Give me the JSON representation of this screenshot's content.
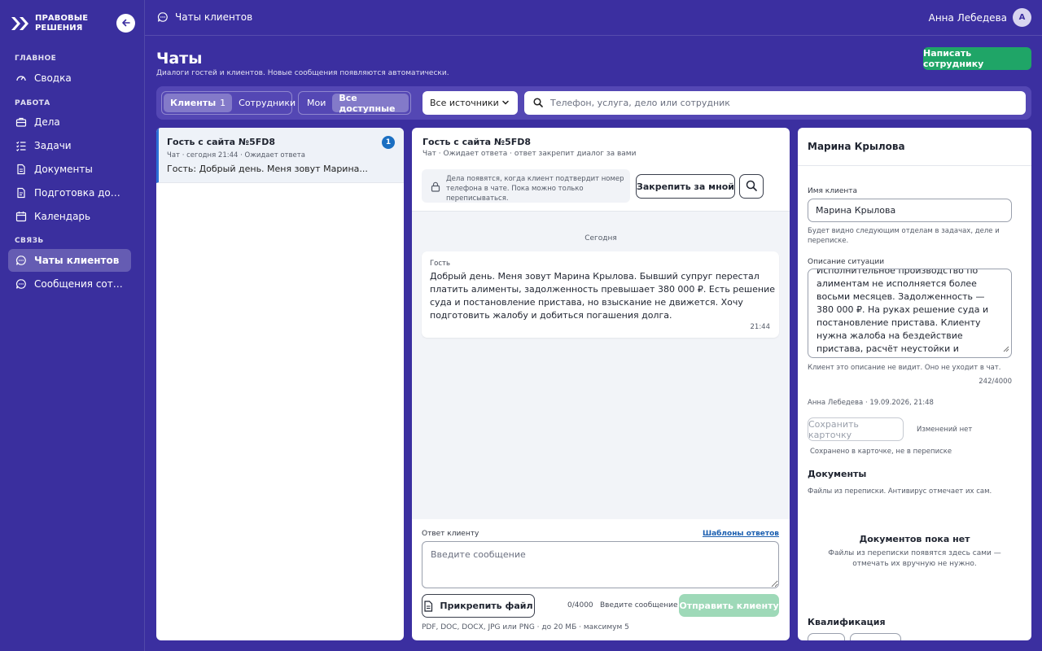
{
  "brand": {
    "line1": "ПРАВОВЫЕ",
    "line2": "РЕШЕНИЯ"
  },
  "sidebar": {
    "sections": [
      {
        "title": "ГЛАВНОЕ"
      },
      {
        "title": "РАБОТА"
      },
      {
        "title": "СВЯЗЬ"
      }
    ],
    "items": [
      {
        "label": "Сводка",
        "icon": "gauge-icon"
      },
      {
        "label": "Дела",
        "icon": "briefcase-icon"
      },
      {
        "label": "Задачи",
        "icon": "checklist-icon"
      },
      {
        "label": "Документы",
        "icon": "document-icon"
      },
      {
        "label": "Подготовка документов",
        "icon": "document-edit-icon"
      },
      {
        "label": "Календарь",
        "icon": "calendar-icon"
      },
      {
        "label": "Чаты клиентов",
        "icon": "chat-icon",
        "active": true
      },
      {
        "label": "Сообщения сотрудников",
        "icon": "chat-icon"
      }
    ]
  },
  "topbar": {
    "crumb": "Чаты клиентов",
    "user_name": "Анна Лебедева",
    "avatar_letter": "А"
  },
  "header": {
    "title": "Чаты",
    "subtitle": "Диалоги гостей и клиентов. Новые сообщения появляются автоматически.",
    "primary_button": "Написать сотруднику"
  },
  "filters": {
    "audience": [
      {
        "label": "Клиенты",
        "count": "1",
        "selected": true
      },
      {
        "label": "Сотрудники"
      }
    ],
    "scope": [
      {
        "label": "Мои"
      },
      {
        "label": "Все доступные",
        "selected": true
      }
    ],
    "source_select": "Все источники",
    "search_placeholder": "Телефон, услуга, дело или сотрудник"
  },
  "chat_list": [
    {
      "title": "Гость с сайта №5FD8",
      "meta": "Чат · сегодня 21:44 · Ожидает ответа",
      "preview": "Гость: Добрый день. Меня зовут Марина...",
      "unread": "1"
    }
  ],
  "chat": {
    "title": "Гость с сайта №5FD8",
    "meta": "Чат · Ожидает ответа · ответ закрепит диалог за вами",
    "notice": "Дела появятся, когда клиент подтвердит номер телефона в чате. Пока можно только переписываться.",
    "pin_button": "Закрепить за мной",
    "day_label": "Сегодня",
    "messages": [
      {
        "author": "Гость",
        "text": "Добрый день. Меня зовут Марина Крылова. Бывший супруг перестал платить алименты, задолженность превышает 380 000 ₽. Есть решение суда и постановление пристава, но взыскание не движется. Хочу подготовить жалобу и добиться погашения долга.",
        "time": "21:44"
      }
    ],
    "reply_label": "Ответ клиенту",
    "templates_link": "Шаблоны ответов",
    "reply_placeholder": "Введите сообщение",
    "attach_button": "Прикрепить файл",
    "counter": "0/4000",
    "send_hint": "Введите сообщение",
    "send_button": "Отправить клиенту",
    "file_note": "PDF, DOC, DOCX, JPG или PNG · до 20 МБ · максимум 5"
  },
  "card": {
    "name": "Марина Крылова",
    "client_name_label": "Имя клиента",
    "client_name_value": "Марина Крылова",
    "client_name_note": "Будет видно следующим отделам в задачах, деле и переписке.",
    "situation_label": "Описание ситуации",
    "situation_text": "Исполнительное производство по алиментам не исполняется более восьми месяцев. Задолженность — 380 000 ₽. На руках решение суда и постановление пристава. Клиенту нужна жалоба на бездействие пристава, расчёт неустойки и сопровождение взыскания.",
    "situation_note": "Клиент это описание не видит. Оно не уходит в чат.",
    "situation_counter": "242/4000",
    "edited_by": "Анна Лебедева · 19.09.2026, 21:48",
    "save_button": "Сохранить карточку",
    "save_status": "Изменений нет",
    "saved_note": "Сохранено в карточке, не в переписке",
    "documents_title": "Документы",
    "documents_note": "Файлы из переписки. Антивирус отмечает их сам.",
    "documents_empty_title": "Документов пока нет",
    "documents_empty_text": "Файлы из переписки появятся здесь сами — отмечать их вручную не нужно.",
    "qualification_title": "Квалификация"
  },
  "colors": {
    "accent": "#3b2fa0",
    "primary_green": "#1fa567",
    "send_disabled": "#9ed9b8",
    "link": "#1b5fb0",
    "badge": "#1b6fc2"
  }
}
